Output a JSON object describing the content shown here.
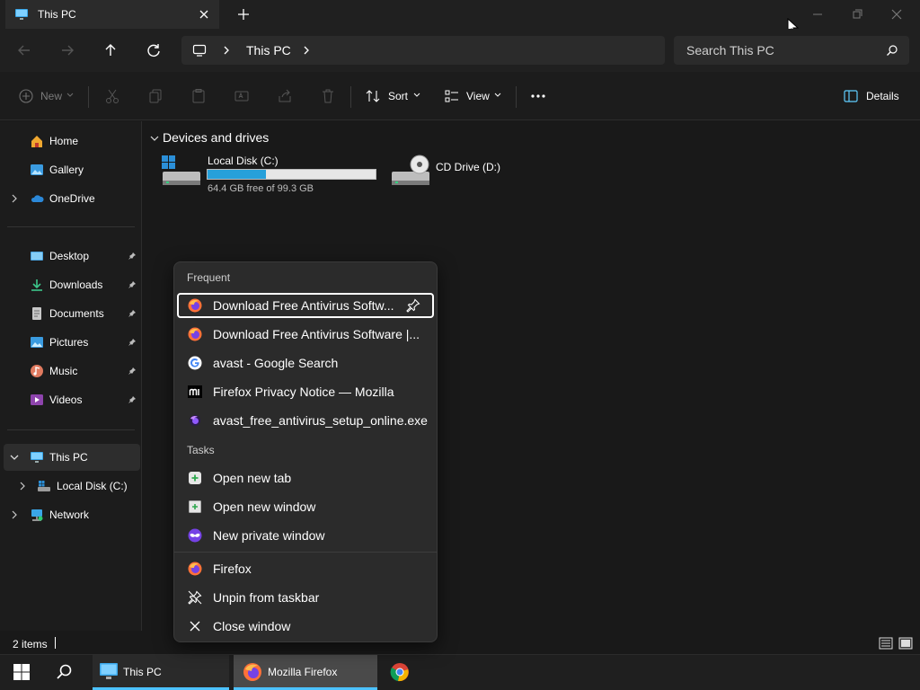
{
  "window": {
    "tab_title": "This PC",
    "address_location": "This PC",
    "search_placeholder": "Search This PC"
  },
  "toolbar": {
    "new_label": "New",
    "sort_label": "Sort",
    "view_label": "View",
    "details_label": "Details"
  },
  "sidebar": {
    "quick": [
      {
        "label": "Home",
        "icon": "home-icon"
      },
      {
        "label": "Gallery",
        "icon": "gallery-icon"
      },
      {
        "label": "OneDrive",
        "icon": "cloud-icon"
      }
    ],
    "pinned": [
      {
        "label": "Desktop",
        "icon": "desktop-icon"
      },
      {
        "label": "Downloads",
        "icon": "download-icon"
      },
      {
        "label": "Documents",
        "icon": "document-icon"
      },
      {
        "label": "Pictures",
        "icon": "picture-icon"
      },
      {
        "label": "Music",
        "icon": "music-icon"
      },
      {
        "label": "Videos",
        "icon": "video-icon"
      }
    ],
    "tree": [
      {
        "label": "This PC",
        "icon": "pc-icon"
      },
      {
        "label": "Local Disk (C:)",
        "icon": "drive-icon"
      },
      {
        "label": "Network",
        "icon": "network-icon"
      }
    ]
  },
  "main": {
    "section_title": "Devices and drives",
    "drives": [
      {
        "label": "Local Disk (C:)",
        "free_text": "64.4 GB free of 99.3 GB",
        "used_fraction": 0.35
      },
      {
        "label": "CD Drive (D:)"
      }
    ]
  },
  "status": {
    "items_count": "2 items"
  },
  "taskbar": {
    "explorer_label": "This PC",
    "firefox_label": "Mozilla Firefox"
  },
  "jumplist": {
    "frequent_header": "Frequent",
    "frequent": [
      {
        "label": "Download Free Antivirus Softw...",
        "icon": "firefox-icon"
      },
      {
        "label": "Download Free Antivirus Software |...",
        "icon": "firefox-icon"
      },
      {
        "label": "avast - Google Search",
        "icon": "google-icon"
      },
      {
        "label": "Firefox Privacy Notice — Mozilla",
        "icon": "mozilla-icon"
      },
      {
        "label": "avast_free_antivirus_setup_online.exe",
        "icon": "firefox-nightly-icon"
      }
    ],
    "tasks_header": "Tasks",
    "tasks": [
      {
        "label": "Open new tab",
        "icon": "new-tab-icon"
      },
      {
        "label": "Open new window",
        "icon": "new-window-icon"
      },
      {
        "label": "New private window",
        "icon": "private-window-icon"
      }
    ],
    "app_actions": [
      {
        "label": "Firefox",
        "icon": "firefox-icon"
      },
      {
        "label": "Unpin from taskbar",
        "icon": "unpin-icon"
      },
      {
        "label": "Close window",
        "icon": "close-icon"
      }
    ]
  }
}
